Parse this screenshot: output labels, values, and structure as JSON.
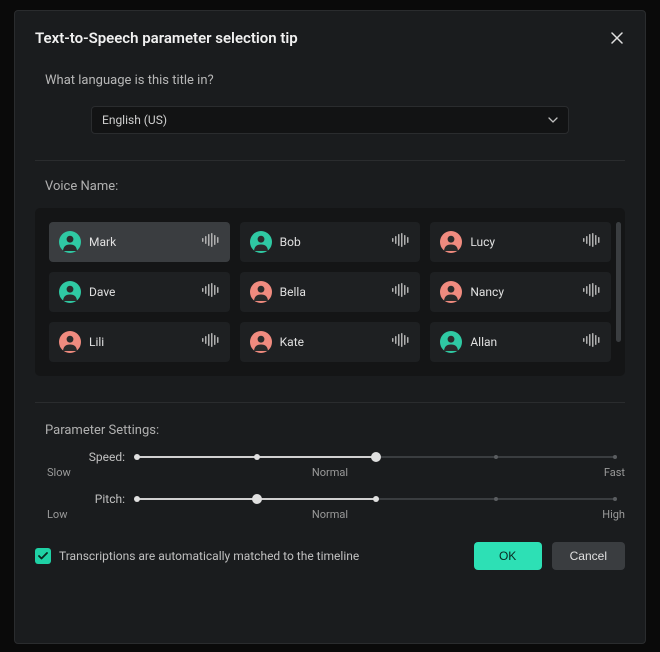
{
  "header": {
    "title": "Text-to-Speech parameter selection tip"
  },
  "language": {
    "question": "What language is this title in?",
    "selected": "English (US)"
  },
  "voice_section": {
    "label": "Voice Name:",
    "voices": [
      {
        "name": "Mark",
        "avatar_color": "#2fc9a3",
        "selected": true
      },
      {
        "name": "Bob",
        "avatar_color": "#2fc9a3",
        "selected": false
      },
      {
        "name": "Lucy",
        "avatar_color": "#f08b7f",
        "selected": false
      },
      {
        "name": "Dave",
        "avatar_color": "#2fc9a3",
        "selected": false
      },
      {
        "name": "Bella",
        "avatar_color": "#f08b7f",
        "selected": false
      },
      {
        "name": "Nancy",
        "avatar_color": "#f08b7f",
        "selected": false
      },
      {
        "name": "Lili",
        "avatar_color": "#f08b7f",
        "selected": false
      },
      {
        "name": "Kate",
        "avatar_color": "#f08b7f",
        "selected": false
      },
      {
        "name": "Allan",
        "avatar_color": "#2fc9a3",
        "selected": false
      }
    ]
  },
  "parameters": {
    "label": "Parameter Settings:",
    "speed": {
      "label": "Speed:",
      "value_pct": 50,
      "ticks": {
        "slow": "Slow",
        "normal": "Normal",
        "fast": "Fast"
      }
    },
    "pitch": {
      "label": "Pitch:",
      "value_pct": 25,
      "ticks": {
        "low": "Low",
        "normal": "Normal",
        "high": "High"
      }
    }
  },
  "footer": {
    "checkbox_checked": true,
    "checkbox_label": "Transcriptions are automatically matched to the timeline",
    "ok_label": "OK",
    "cancel_label": "Cancel"
  },
  "colors": {
    "accent": "#2de0b5"
  }
}
